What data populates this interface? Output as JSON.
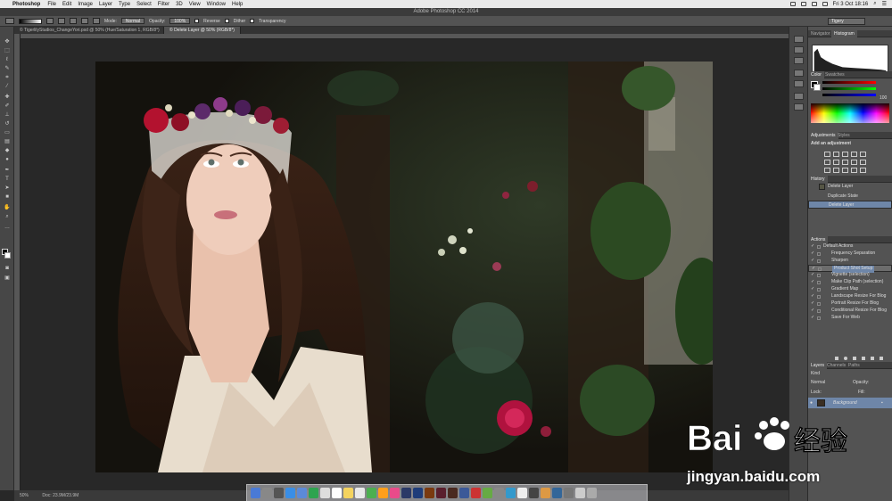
{
  "menubar": {
    "app_name": "Photoshop",
    "items": [
      "File",
      "Edit",
      "Image",
      "Layer",
      "Type",
      "Select",
      "Filter",
      "3D",
      "View",
      "Window",
      "Help"
    ],
    "clock": "Fri 3 Oct 18:16"
  },
  "window_title": "Adobe Photoshop CC 2014",
  "options": {
    "mode_label": "Mode:",
    "mode_value": "Normal",
    "opacity_label": "Opacity:",
    "opacity_value": "100%",
    "reverse_label": "Reverse",
    "dither_label": "Dither",
    "transparency_label": "Transparency",
    "workspace_value": "Tigery"
  },
  "tabs": [
    {
      "label": "© TigerlilyStudios_ChangeYori.psd @ 50% (Hue/Saturation 1, RGB/8*)"
    },
    {
      "label": "© Delete Layer @ 50% (RGB/8*)"
    }
  ],
  "status": {
    "zoom": "50%",
    "doc": "Doc: 23.9M/23.9M"
  },
  "panels": {
    "navigator_tab": "Navigator",
    "histogram_tab": "Histogram",
    "color_tab": "Color",
    "swatches_tab": "Swatches",
    "color_value": "100",
    "adjustments_tab": "Adjustments",
    "styles_tab": "Styles",
    "add_adjustment": "Add an adjustment",
    "history_tab": "History",
    "history_items": [
      {
        "label": "Delete Layer"
      },
      {
        "label": "Duplicate State"
      },
      {
        "label": "Delete Layer"
      }
    ],
    "actions_tab": "Actions",
    "actions": [
      {
        "label": "Default Actions"
      },
      {
        "label": "Frequency Separation"
      },
      {
        "label": "Sharpen"
      },
      {
        "label": "Product Shot Setup"
      },
      {
        "label": "Vignette (selection)"
      },
      {
        "label": "Make Clip Path (selection)"
      },
      {
        "label": "Gradient Map"
      },
      {
        "label": "Landscape Resize For Blog"
      },
      {
        "label": "Portrait Resize For Blog"
      },
      {
        "label": "Conditional Resize For Blog"
      },
      {
        "label": "Save For Web"
      }
    ],
    "layers_tab": "Layers",
    "channels_tab": "Channels",
    "paths_tab": "Paths",
    "kind_label": "Kind",
    "blend_value": "Normal",
    "opacity_label": "Opacity:",
    "lock_label": "Lock:",
    "fill_label": "Fill:",
    "layer_name": "Background"
  },
  "watermark": {
    "brand": "Bai",
    "brand_cn": "经验",
    "url": "jingyan.baidu.com"
  },
  "colors": {
    "selection_blue": "#6e86a8",
    "panel_gray": "#535353",
    "canvas_bg": "#282828"
  }
}
